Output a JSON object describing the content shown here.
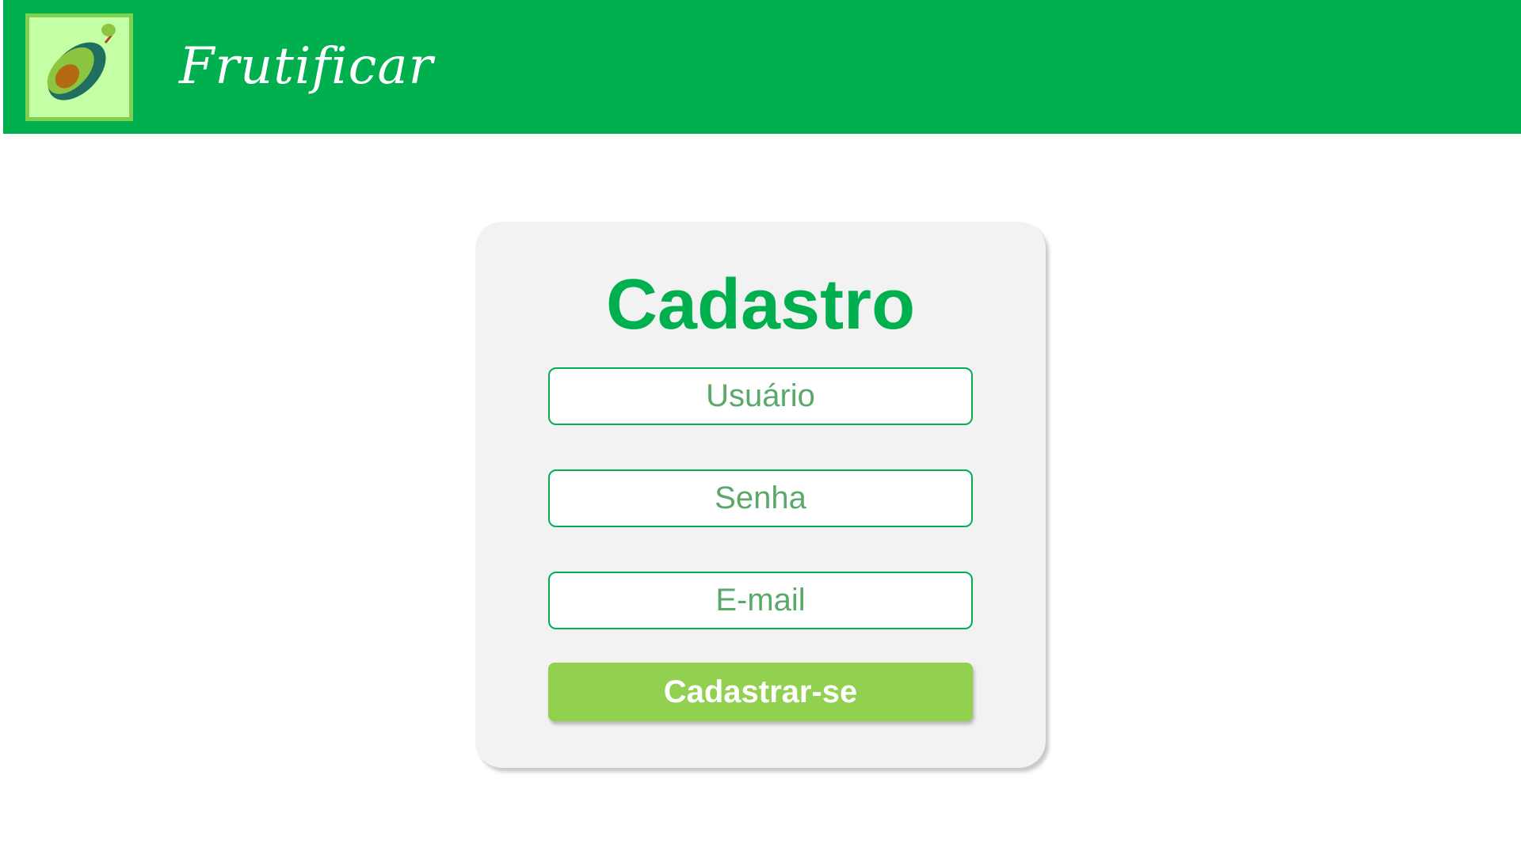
{
  "header": {
    "brand": "Frutificar",
    "logo_icon": "avocado-icon",
    "background_color": "#00b04f"
  },
  "form": {
    "title": "Cadastro",
    "username_placeholder": "Usuário",
    "password_placeholder": "Senha",
    "email_placeholder": "E-mail",
    "submit_label": "Cadastrar-se",
    "accent_color": "#00b04f",
    "button_color": "#92d050"
  }
}
